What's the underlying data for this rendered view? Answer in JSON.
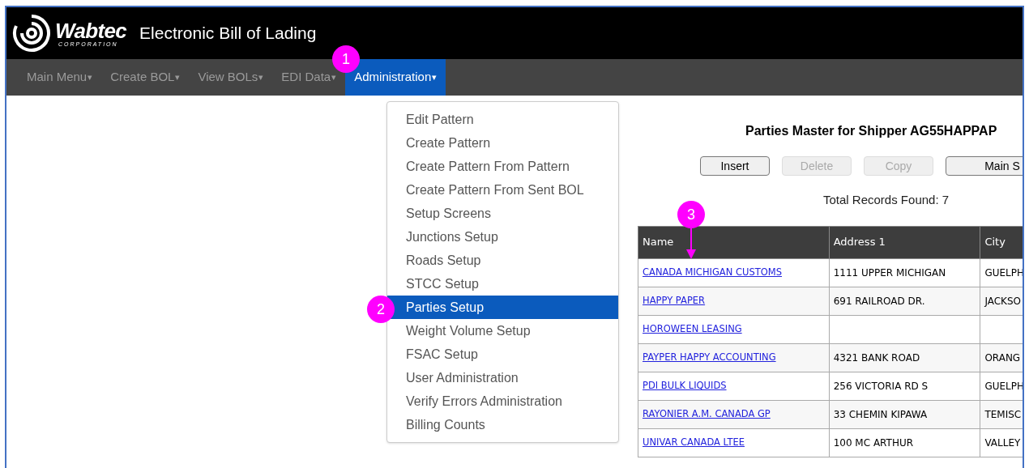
{
  "header": {
    "logo_word": "Wabtec",
    "logo_sub": "CORPORATION",
    "title": "Electronic Bill of Lading"
  },
  "nav": [
    {
      "label": "Main Menu",
      "caret": "▾",
      "selected": false
    },
    {
      "label": "Create BOL",
      "caret": "▾",
      "selected": false
    },
    {
      "label": "View BOLs",
      "caret": "▾",
      "selected": false
    },
    {
      "label": "EDI Data",
      "caret": "▾",
      "selected": false
    },
    {
      "label": "Administration",
      "caret": "▾",
      "selected": true
    }
  ],
  "dropdown": [
    {
      "label": "Edit Pattern",
      "selected": false
    },
    {
      "label": "Create Pattern",
      "selected": false
    },
    {
      "label": "Create Pattern From Pattern",
      "selected": false
    },
    {
      "label": "Create Pattern From Sent BOL",
      "selected": false
    },
    {
      "label": "Setup Screens",
      "selected": false
    },
    {
      "label": "Junctions Setup",
      "selected": false
    },
    {
      "label": "Roads Setup",
      "selected": false
    },
    {
      "label": "STCC Setup",
      "selected": false
    },
    {
      "label": "Parties Setup",
      "selected": true
    },
    {
      "label": "Weight Volume Setup",
      "selected": false
    },
    {
      "label": "FSAC Setup",
      "selected": false
    },
    {
      "label": "User Administration",
      "selected": false
    },
    {
      "label": "Verify Errors Administration",
      "selected": false
    },
    {
      "label": "Billing Counts",
      "selected": false
    }
  ],
  "panel": {
    "title": "Parties Master for Shipper AG55HAPPAP",
    "buttons": [
      {
        "label": "Insert",
        "disabled": false
      },
      {
        "label": "Delete",
        "disabled": true
      },
      {
        "label": "Copy",
        "disabled": true
      },
      {
        "label": "Main S",
        "disabled": false
      }
    ],
    "total": "Total Records Found: 7"
  },
  "table": {
    "columns": [
      "Name",
      "Address 1",
      "City"
    ],
    "rows": [
      [
        "CANADA MICHIGAN CUSTOMS",
        "1111 UPPER MICHIGAN",
        "GUELPH"
      ],
      [
        "HAPPY PAPER",
        "691 RAILROAD DR.",
        "JACKSO"
      ],
      [
        "HOROWEEN LEASING",
        "",
        ""
      ],
      [
        "PAYPER HAPPY ACCOUNTING",
        "4321 BANK ROAD",
        "ORANG"
      ],
      [
        "PDI BULK LIQUIDS",
        "256 VICTORIA RD S",
        "GUELPH"
      ],
      [
        "RAYONIER A.M. CANADA GP",
        "33 CHEMIN KIPAWA",
        "TEMISC"
      ],
      [
        "UNIVAR CANADA LTEE",
        "100 MC ARTHUR",
        "VALLEY"
      ]
    ]
  },
  "callouts": [
    {
      "number": "1",
      "kind": "plain"
    },
    {
      "number": "2",
      "kind": "plain"
    },
    {
      "number": "3",
      "kind": "arrow"
    }
  ]
}
